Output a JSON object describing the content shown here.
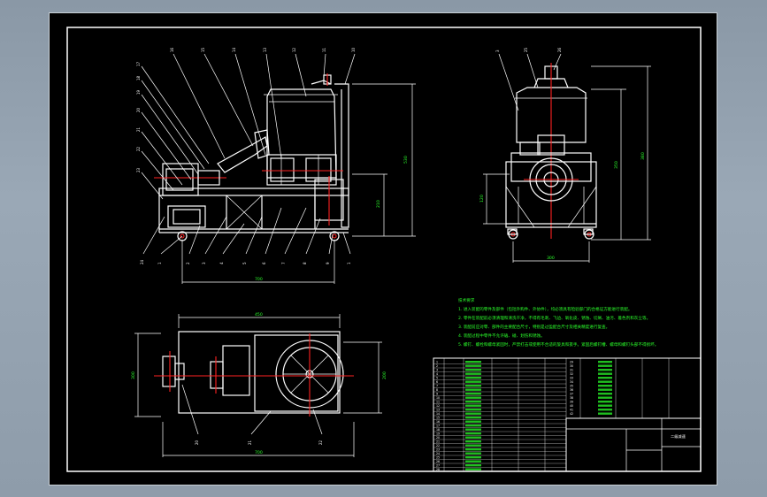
{
  "drawing": {
    "title_block_name": "二级减速",
    "technical_requirements": {
      "heading": "技术要求",
      "lines": [
        "1. 进入装配的零件及部件（包括外购件、外协件），均必须具有检验部门的合格证方能进行装配。",
        "2. 零件在装配前必须清理和清洗干净，不得有毛刺、飞边、氧化皮、锈蚀、切屑、油污、着色剂和灰尘等。",
        "3. 装配前应对零、部件的主要配合尺寸，特别是过盈配合尺寸及相关精度进行复查。",
        "4. 装配过程中零件不允许磕、碰、划伤和锈蚀。",
        "5. 螺钉、螺栓和螺母紧固时，严禁打击或使用不合适的旋具和扳手。紧固后螺钉槽、螺母和螺钉头部不得损坏。"
      ]
    },
    "front_view": {
      "top_labels": [
        "16",
        "15",
        "14",
        "13",
        "12",
        "11",
        "10"
      ],
      "left_labels": [
        "17",
        "18",
        "19",
        "20",
        "21",
        "22",
        "23"
      ],
      "bottom_labels": [
        "24",
        "1",
        "2",
        "3",
        "4",
        "5",
        "6",
        "7",
        "8",
        "9",
        "1"
      ],
      "dims": {
        "height_total": "530",
        "height_partial": "210",
        "width": "700"
      }
    },
    "side_view": {
      "top_labels": [
        "3",
        "25",
        "26"
      ],
      "dims": {
        "height_a": "380",
        "height_b": "350",
        "height_c": "120",
        "width": "300"
      }
    },
    "plan_view": {
      "bottom_labels": [
        "20",
        "21",
        "22"
      ],
      "dims": {
        "top_width": "450",
        "left_height": "300",
        "right_height": "200",
        "bottom_width": "700"
      }
    },
    "parts_list": {
      "left_column": [
        "1",
        "2",
        "3",
        "4",
        "5",
        "6",
        "7",
        "8",
        "9",
        "10",
        "11",
        "12",
        "13",
        "14",
        "15",
        "16",
        "17",
        "18",
        "19",
        "20",
        "21",
        "22",
        "23",
        "24",
        "25",
        "26",
        "27",
        "28"
      ],
      "right_column": [
        "29",
        "30",
        "31",
        "32",
        "33",
        "34",
        "35",
        "36",
        "37",
        "38",
        "39",
        "40",
        "41",
        "42",
        "43",
        "44",
        "45",
        "46",
        "47",
        "48",
        "49",
        "50",
        "51",
        "52",
        "53",
        "54",
        "55",
        "56"
      ]
    }
  }
}
